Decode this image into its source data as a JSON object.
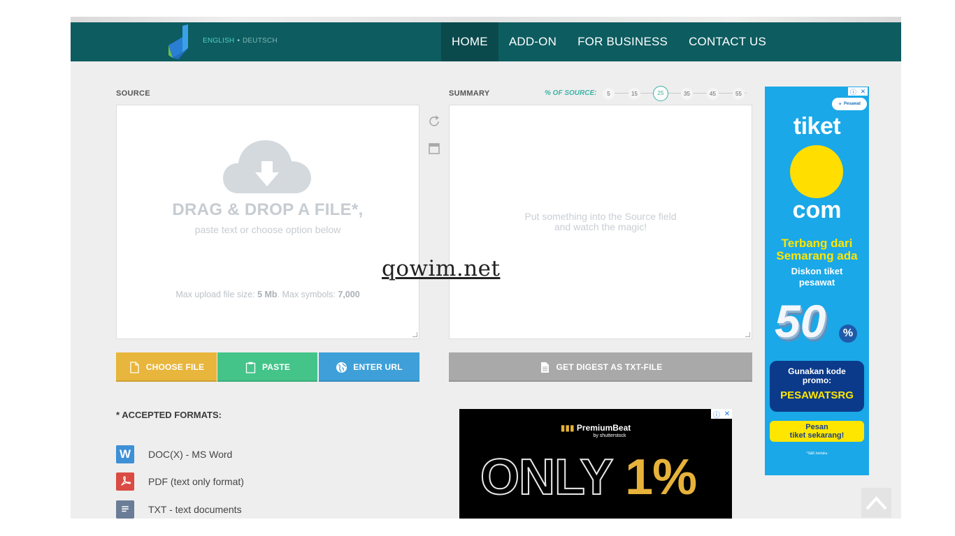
{
  "nav": {
    "lang_english": "ENGLISH",
    "lang_sep": "•",
    "lang_deutsch": "DEUTSCH",
    "items": [
      {
        "label": "HOME",
        "active": true
      },
      {
        "label": "ADD-ON",
        "active": false
      },
      {
        "label": "FOR BUSINESS",
        "active": false
      },
      {
        "label": "CONTACT US",
        "active": false
      }
    ]
  },
  "source": {
    "label": "SOURCE",
    "dropzone_title": "DRAG & DROP A FILE*,",
    "dropzone_subtitle": "paste text or choose option below",
    "limits_prefix": "Max upload file size: ",
    "limits_size": "5 Mb",
    "limits_mid": ". Max symbols: ",
    "limits_symbols": "7,000"
  },
  "summary": {
    "label": "SUMMARY",
    "percent_label": "% OF SOURCE:",
    "percent_steps": [
      "5",
      "15",
      "25",
      "35",
      "45",
      "55"
    ],
    "percent_selected": "25",
    "placeholder_line1": "Put something into the Source field",
    "placeholder_line2": "and watch the magic!"
  },
  "buttons": {
    "choose_file": "CHOOSE FILE",
    "paste": "PASTE",
    "enter_url": "ENTER URL",
    "get_digest": "GET DIGEST AS TXT-FILE"
  },
  "formats": {
    "title": "* ACCEPTED FORMATS:",
    "items": [
      {
        "label": "DOC(X) - MS Word",
        "icon": "word-icon",
        "color": "#3d8fd6"
      },
      {
        "label": "PDF (text only format)",
        "icon": "pdf-icon",
        "color": "#d94b43"
      },
      {
        "label": "TXT - text documents",
        "icon": "txt-icon",
        "color": "#6b7c96"
      }
    ]
  },
  "ad_side": {
    "pill": "Pesawat",
    "brand_top": "tiket",
    "brand_bottom": "com",
    "headline_1": "Terbang dari",
    "headline_2": "Semarang ada",
    "sub_1": "Diskon tiket",
    "sub_2": "pesawat",
    "discount": "50",
    "percent": "%",
    "promo_label_1": "Gunakan kode",
    "promo_label_2": "promo:",
    "promo_code": "PESAWATSRG",
    "cta_1": "Pesan",
    "cta_2": "tiket sekarang!",
    "fine_print": "*S&K berlaku"
  },
  "ad_bottom": {
    "brand": "PremiumBeat",
    "brand_by": "by shutterstock",
    "headline_text": "ONLY ",
    "headline_pct": "1%"
  },
  "watermark": "qowim.net",
  "colors": {
    "nav_bg": "#0d5c60",
    "nav_active": "#0a4a4d",
    "accent_teal": "#3bb3a6",
    "choose": "#e8b63c",
    "paste": "#45c48a",
    "url": "#3fa0d9",
    "digest": "#a9a9a9"
  }
}
